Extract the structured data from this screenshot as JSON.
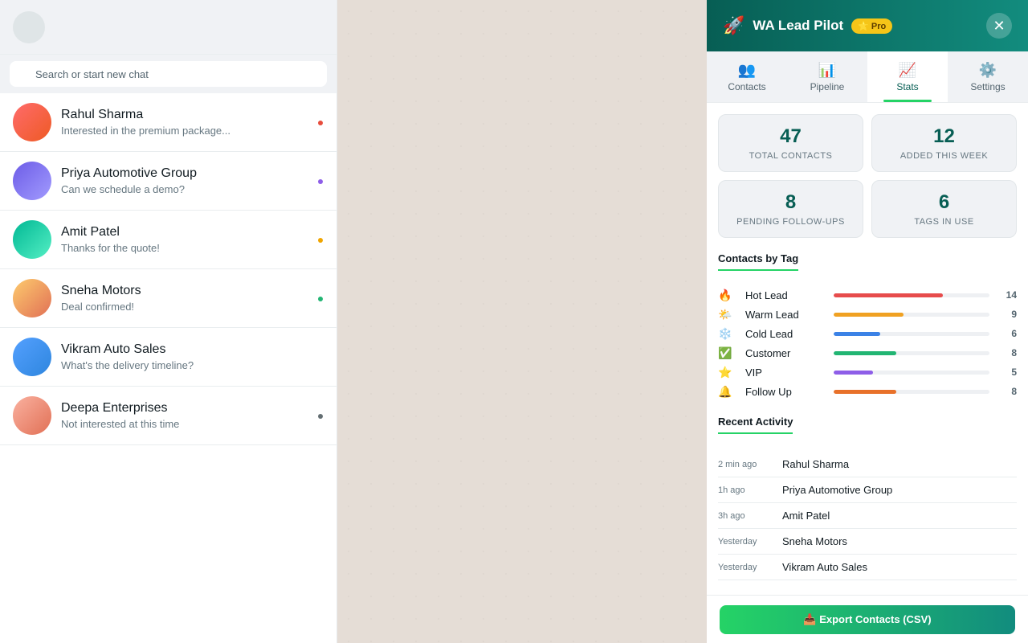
{
  "search": {
    "placeholder": "Search or start new chat"
  },
  "chats": [
    {
      "name": "Rahul Sharma",
      "preview": "Interested in the premium package...",
      "avatar_gradient": [
        "#ff6b6b",
        "#ee5a24"
      ],
      "tag_color": "#e74c3c"
    },
    {
      "name": "Priya Automotive Group",
      "preview": "Can we schedule a demo?",
      "avatar_gradient": [
        "#6c5ce7",
        "#a29bfe"
      ],
      "tag_color": "#8e5ee8"
    },
    {
      "name": "Amit Patel",
      "preview": "Thanks for the quote!",
      "avatar_gradient": [
        "#00b894",
        "#55efc4"
      ],
      "tag_color": "#f0a500"
    },
    {
      "name": "Sneha Motors",
      "preview": "Deal confirmed!",
      "avatar_gradient": [
        "#fdcb6e",
        "#e17055"
      ],
      "tag_color": "#22b573"
    },
    {
      "name": "Vikram Auto Sales",
      "preview": "What's the delivery timeline?",
      "avatar_gradient": [
        "#54a0ff",
        "#2e86de"
      ],
      "tag_color": null
    },
    {
      "name": "Deepa Enterprises",
      "preview": "Not interested at this time",
      "avatar_gradient": [
        "#fab1a0",
        "#e17055"
      ],
      "tag_color": "#636e72"
    }
  ],
  "panel": {
    "icon": "rocket-icon",
    "title": "WA Lead Pilot",
    "badge": "⭐ Pro",
    "close_label": "✕"
  },
  "tabs": [
    {
      "icon": "👥",
      "icon_name": "contacts-icon",
      "label": "Contacts",
      "active": false
    },
    {
      "icon": "📊",
      "icon_name": "pipeline-icon",
      "label": "Pipeline",
      "active": false
    },
    {
      "icon": "📈",
      "icon_name": "stats-icon",
      "label": "Stats",
      "active": true
    },
    {
      "icon": "⚙️",
      "icon_name": "settings-icon",
      "label": "Settings",
      "active": false
    }
  ],
  "stats": [
    {
      "value": "47",
      "label": "TOTAL CONTACTS"
    },
    {
      "value": "12",
      "label": "ADDED THIS WEEK"
    },
    {
      "value": "8",
      "label": "PENDING FOLLOW-UPS"
    },
    {
      "value": "6",
      "label": "TAGS IN USE"
    }
  ],
  "tags_section": {
    "title": "Contacts by Tag"
  },
  "chart_data": {
    "type": "bar",
    "categories": [
      "Hot Lead",
      "Warm Lead",
      "Cold Lead",
      "Customer",
      "VIP",
      "Follow Up"
    ],
    "values": [
      14,
      9,
      6,
      8,
      5,
      8
    ],
    "xlim": [
      0,
      20
    ]
  },
  "tags": [
    {
      "emoji": "🔥",
      "icon_name": "fire-icon",
      "label": "Hot Lead",
      "count": 14,
      "color": "#e74c4c"
    },
    {
      "emoji": "🌤️",
      "icon_name": "sun-cloud-icon",
      "label": "Warm Lead",
      "count": 9,
      "color": "#f0a122"
    },
    {
      "emoji": "❄️",
      "icon_name": "snowflake-icon",
      "label": "Cold Lead",
      "count": 6,
      "color": "#3b82e6"
    },
    {
      "emoji": "✅",
      "icon_name": "check-icon",
      "label": "Customer",
      "count": 8,
      "color": "#22b573"
    },
    {
      "emoji": "⭐",
      "icon_name": "star-icon",
      "label": "VIP",
      "count": 5,
      "color": "#8e5ee8"
    },
    {
      "emoji": "🔔",
      "icon_name": "bell-icon",
      "label": "Follow Up",
      "count": 8,
      "color": "#e8712a"
    }
  ],
  "activity_section": {
    "title": "Recent Activity"
  },
  "activity": [
    {
      "time": "2 min ago",
      "name": "Rahul Sharma"
    },
    {
      "time": "1h ago",
      "name": "Priya Automotive Group"
    },
    {
      "time": "3h ago",
      "name": "Amit Patel"
    },
    {
      "time": "Yesterday",
      "name": "Sneha Motors"
    },
    {
      "time": "Yesterday",
      "name": "Vikram Auto Sales"
    }
  ],
  "footer": {
    "export_label": "📥 Export Contacts (CSV)"
  }
}
